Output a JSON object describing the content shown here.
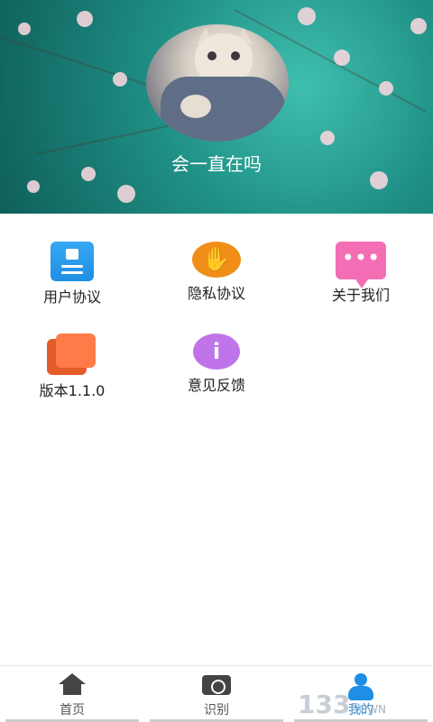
{
  "profile": {
    "username": "会一直在吗"
  },
  "menu": [
    {
      "label": "用户协议",
      "icon": "user-agreement-icon"
    },
    {
      "label": "隐私协议",
      "icon": "hand-privacy-icon"
    },
    {
      "label": "关于我们",
      "icon": "about-chat-icon"
    },
    {
      "label": "版本1.1.0",
      "icon": "version-layers-icon"
    },
    {
      "label": "意见反馈",
      "icon": "feedback-info-icon"
    }
  ],
  "tabs": [
    {
      "label": "首页",
      "icon": "home-icon"
    },
    {
      "label": "识别",
      "icon": "camera-icon"
    },
    {
      "label": "我的",
      "icon": "user-icon"
    }
  ],
  "watermark": {
    "text": "133",
    "sub": "DOWN"
  },
  "colors": {
    "accent": "#1e8fe4",
    "header": "#2a9f95"
  }
}
